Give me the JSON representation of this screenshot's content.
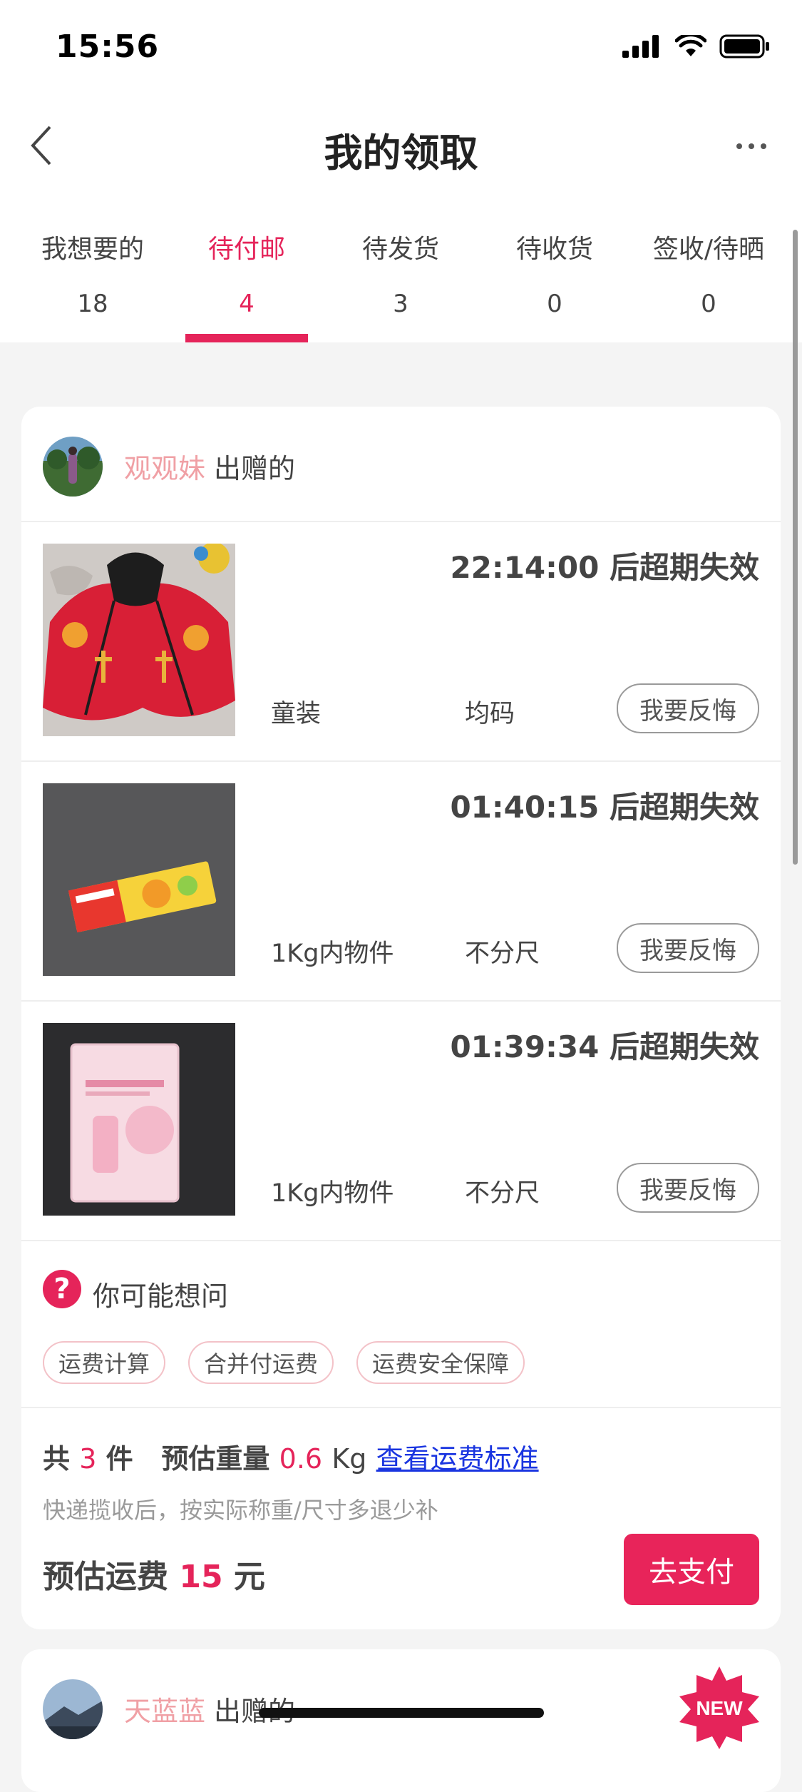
{
  "status_bar": {
    "time": "15:56"
  },
  "nav": {
    "title": "我的领取",
    "back_icon": "chevron-left-icon",
    "more_icon": "ellipsis-icon"
  },
  "tabs": [
    {
      "label": "我想要的",
      "count": "18",
      "active": false
    },
    {
      "label": "待付邮",
      "count": "4",
      "active": true
    },
    {
      "label": "待发货",
      "count": "3",
      "active": false
    },
    {
      "label": "待收货",
      "count": "0",
      "active": false
    },
    {
      "label": "签收/待晒",
      "count": "0",
      "active": false
    }
  ],
  "orders": [
    {
      "giver_name": "观观妹",
      "giver_suffix": "出赠的",
      "items": [
        {
          "expire": "22:14:00 后超期失效",
          "category": "童装",
          "size": "均码",
          "action": "我要反悔",
          "image": "red-cape-photo"
        },
        {
          "expire": "01:40:15 后超期失效",
          "category": "1Kg内物件",
          "size": "不分尺",
          "action": "我要反悔",
          "image": "toothpaste-box-photo"
        },
        {
          "expire": "01:39:34 后超期失效",
          "category": "1Kg内物件",
          "size": "不分尺",
          "action": "我要反悔",
          "image": "cream-box-photo"
        }
      ],
      "faq": {
        "title": "你可能想问",
        "tags": [
          "运费计算",
          "合并付运费",
          "运费安全保障"
        ]
      },
      "summary": {
        "count_prefix": "共",
        "count": "3",
        "count_suffix": "件",
        "weight_label": "预估重量",
        "weight": "0.6",
        "weight_unit": "Kg",
        "link": "查看运费标准",
        "hint": "快递揽收后，按实际称重/尺寸多退少补",
        "fee_label": "预估运费",
        "fee": "15",
        "fee_unit": "元",
        "pay_button": "去支付"
      }
    },
    {
      "giver_name": "天蓝蓝",
      "giver_suffix": "出赠的",
      "badge": "NEW"
    }
  ],
  "colors": {
    "accent": "#e5245a",
    "link": "#1a35e0",
    "giver_name": "#f0a0a5"
  }
}
